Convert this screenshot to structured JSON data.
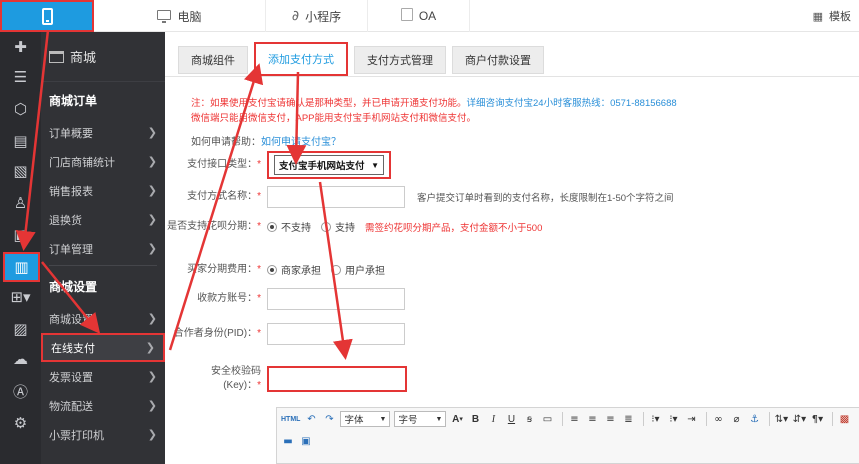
{
  "topbar": {
    "tabs": [
      {
        "label": "电脑",
        "icon": "monitor-icon"
      },
      {
        "label": "小程序",
        "icon": "miniprogram-icon"
      },
      {
        "label": "OA",
        "icon": "oa-icon"
      }
    ],
    "template_label": "模板"
  },
  "iconbar": {
    "items": [
      "plus-cross-icon",
      "list-icon",
      "cube-icon",
      "document-icon",
      "image-icon",
      "user-icon",
      "monitor-card-icon",
      "clipboard-icon",
      "apps-grid-icon",
      "form-icon",
      "chat-icon",
      "store-app-icon",
      "gear-icon"
    ]
  },
  "sidebar": {
    "header": "商城",
    "sections": [
      {
        "title": "商城订单",
        "items": [
          "订单概要",
          "门店商铺统计",
          "销售报表",
          "退换货",
          "订单管理"
        ]
      },
      {
        "title": "商城设置",
        "items": [
          "商城设置",
          "在线支付",
          "发票设置",
          "物流配送",
          "小票打印机"
        ]
      }
    ]
  },
  "tabs": [
    "商城组件",
    "添加支付方式",
    "支付方式管理",
    "商户付款设置"
  ],
  "notice": {
    "line1_red": "注：如果使用支付宝请确认是那种类型，并已申请开通支付功能。",
    "line1_blue": "详细咨询支付宝24小时客服热线：0571-88156688",
    "line2": "微信端只能用微信支付，APP能用支付宝手机网站支付和微信支付。"
  },
  "help": {
    "label": "如何申请帮助：",
    "link": "如何申请支付宝？"
  },
  "form": {
    "interface_type_label": "支付接口类型：",
    "interface_type_value": "支付宝手机网站支付",
    "name_label": "支付方式名称：",
    "name_hint": "客户提交订单时看到的支付名称，长度限制在1-50个字符之间",
    "huabei_label": "是否支持花呗分期：",
    "huabei_options": [
      "不支持",
      "支持"
    ],
    "huabei_note": "需签约花呗分期产品，支付金额不小于500",
    "fee_label": "买家分期费用：",
    "fee_options": [
      "商家承担",
      "用户承担"
    ],
    "account_label": "收款方账号：",
    "pid_label": "合作者身份(PID)：",
    "key_label_1": "安全校验码",
    "key_label_2": "(Key)："
  },
  "editor": {
    "font_family": "字体",
    "font_size": "字号",
    "bold": "B",
    "italic": "I",
    "underline": "U"
  }
}
